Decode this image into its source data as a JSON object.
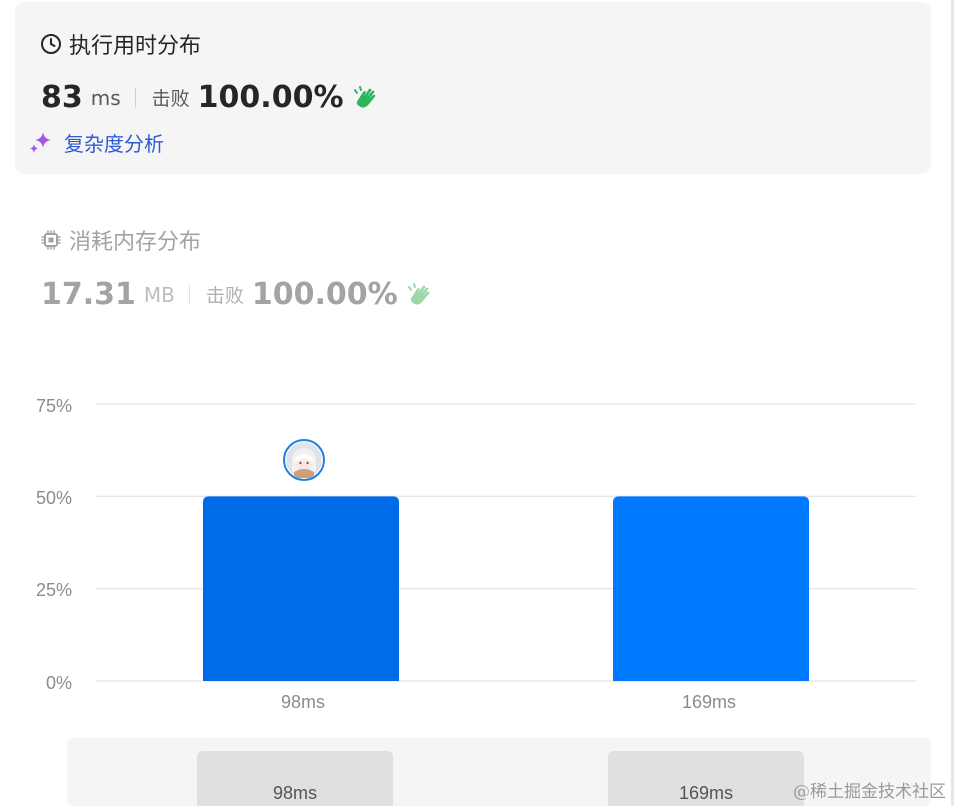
{
  "runtime": {
    "title": "执行用时分布",
    "value": "83",
    "unit": "ms",
    "beat_label": "击败",
    "beat_percent": "100.00%",
    "icon": "clock-icon",
    "complexity_link": "复杂度分析"
  },
  "memory": {
    "title": "消耗内存分布",
    "value": "17.31",
    "unit": "MB",
    "beat_label": "击败",
    "beat_percent": "100.00%",
    "icon": "chip-icon"
  },
  "chart_data": {
    "type": "bar",
    "categories": [
      "98ms",
      "169ms"
    ],
    "values": [
      50,
      50
    ],
    "y_unit": "%",
    "ylim": [
      0,
      75
    ],
    "yticks": [
      "0%",
      "25%",
      "50%",
      "75%"
    ],
    "highlighted_index": 0,
    "colors": [
      "#006be6",
      "#0079fe"
    ],
    "grid": true
  },
  "range_slider": {
    "start_label": "98ms",
    "end_label": "169ms"
  },
  "watermark": "@稀土掘金技术社区",
  "colors": {
    "card_bg": "#f5f5f5",
    "clap_green": "#2db55d",
    "clap_light": "#9bd8a9",
    "link_blue": "#2d5bd3",
    "bar_blue": "#0079fe"
  }
}
